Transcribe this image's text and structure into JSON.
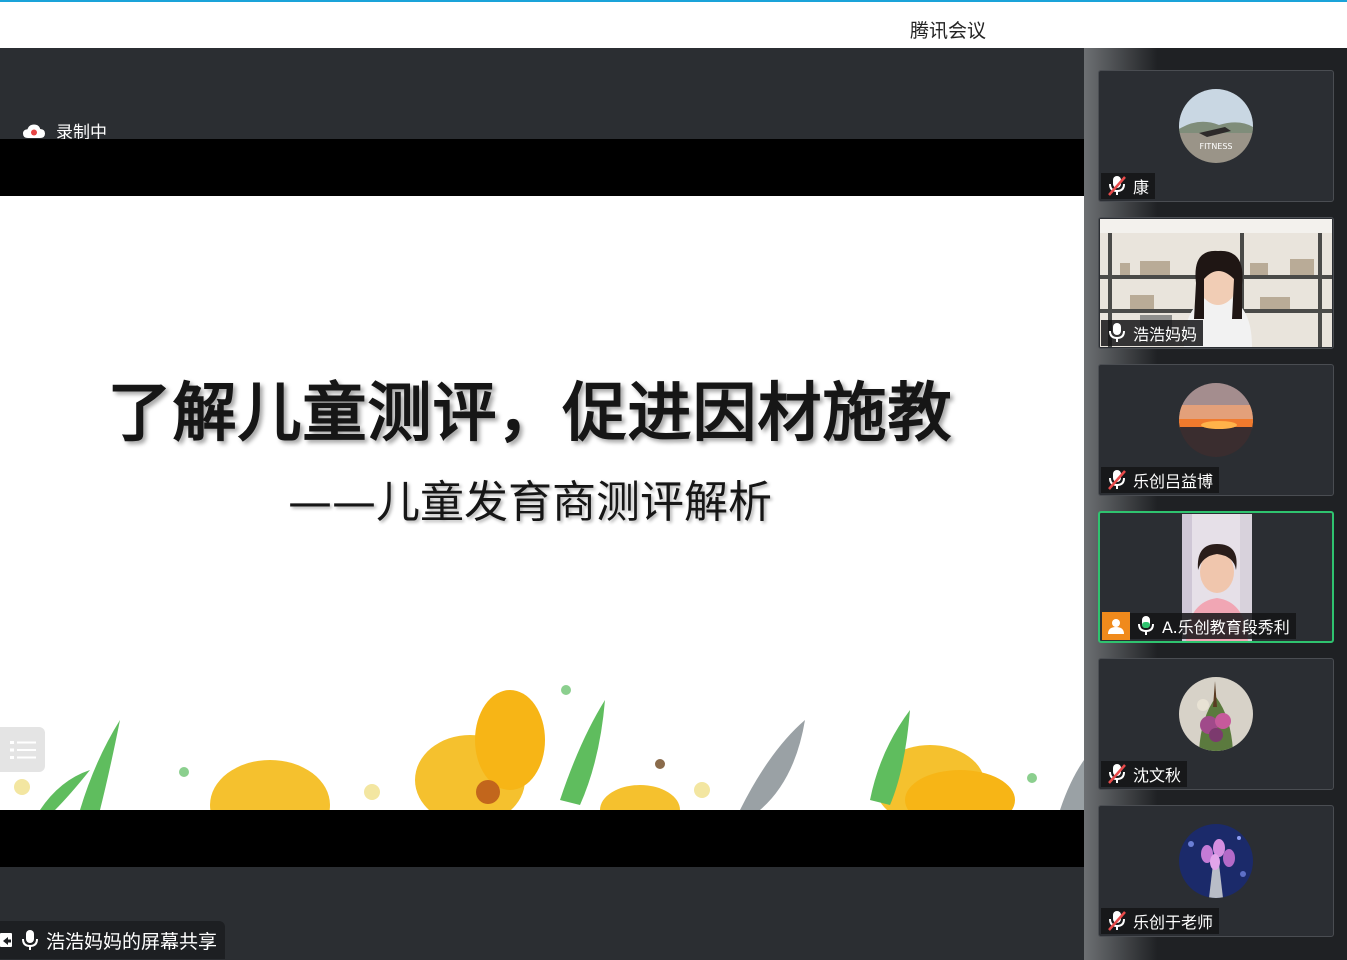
{
  "app": {
    "title": "腾讯会议"
  },
  "recording": {
    "label": "录制中"
  },
  "slide": {
    "title": "了解儿童测评，促进因材施教",
    "subtitle": "——儿童发育商测评解析"
  },
  "share": {
    "label": "浩浩妈妈的屏幕共享"
  },
  "participants": [
    {
      "name": "康",
      "muted": true,
      "avatar": "fitness-photo"
    },
    {
      "name": "浩浩妈妈",
      "muted": false,
      "video": true
    },
    {
      "name": "乐创吕益博",
      "muted": true,
      "avatar": "sunset-photo"
    },
    {
      "name": "A.乐创教育段秀利",
      "muted": false,
      "video": true,
      "speaking": true
    },
    {
      "name": "沈文秋",
      "muted": true,
      "avatar": "flowers-photo"
    },
    {
      "name": "乐创于老师",
      "muted": true,
      "avatar": "tulips-photo"
    }
  ],
  "colors": {
    "accent": "#1aa3d9",
    "speaking": "#2fc36f",
    "badge": "#f08a1c"
  }
}
